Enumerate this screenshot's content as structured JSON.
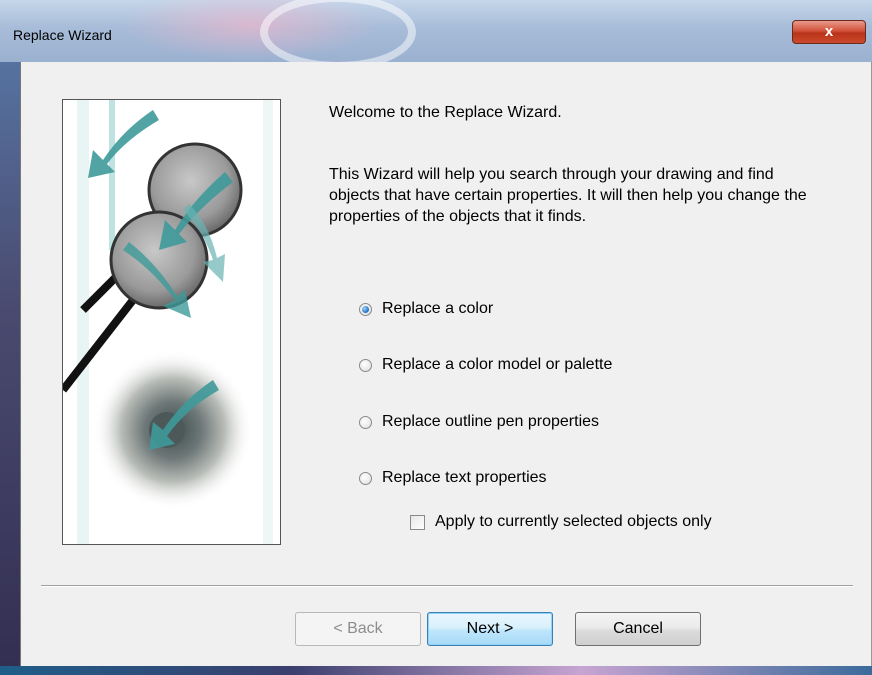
{
  "window": {
    "title": "Replace Wizard",
    "close_label": "x"
  },
  "main": {
    "welcome": "Welcome to the Replace Wizard.",
    "description": "This Wizard will help you search through your drawing and find objects that have certain properties. It will then help you change the properties of the objects that it finds.",
    "options": [
      {
        "label": "Replace a color",
        "selected": true
      },
      {
        "label": "Replace a color model or palette",
        "selected": false
      },
      {
        "label": "Replace outline pen properties",
        "selected": false
      },
      {
        "label": "Replace text properties",
        "selected": false
      }
    ],
    "checkbox": {
      "label": "Apply to currently selected objects only",
      "checked": false
    }
  },
  "buttons": {
    "back": "< Back",
    "next": "Next >",
    "cancel": "Cancel"
  },
  "colors": {
    "accent_teal": "#3f9a9a",
    "dialog_bg": "#f0f0f0"
  }
}
